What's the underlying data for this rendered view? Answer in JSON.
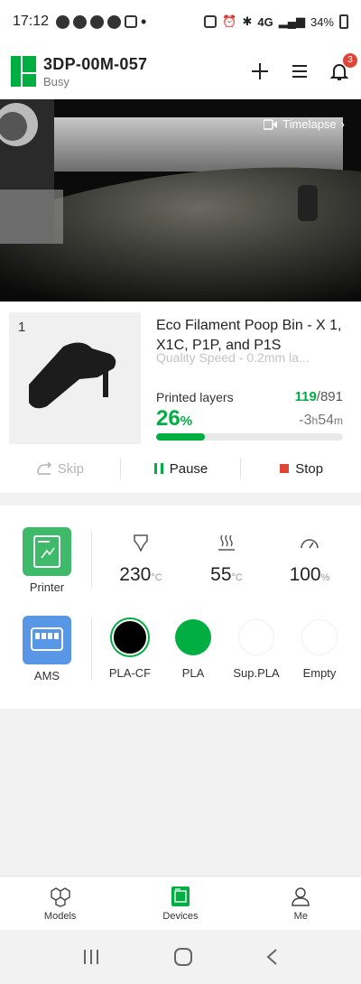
{
  "status_bar": {
    "time": "17:12",
    "network": "4G",
    "battery": "34%",
    "icons": [
      "chat-icon",
      "snapchat-icon",
      "at-icon",
      "clock-icon",
      "calendar-icon",
      "battery-saver-icon",
      "alarm-icon",
      "bluetooth-icon",
      "signal-icon"
    ]
  },
  "header": {
    "title": "3DP-00M-057",
    "status": "Busy",
    "notification_count": "3"
  },
  "camera": {
    "timelapse_label": "Timelapse"
  },
  "job": {
    "plate_number": "1",
    "name": "Eco Filament Poop Bin - X 1, X1C, P1P, and P1S",
    "subtitle": "Quality Speed - 0.2mm la...",
    "layers_label": "Printed layers",
    "layers_current": "119",
    "layers_total": "/891",
    "percent": "26",
    "percent_unit": "%",
    "progress": 0.26,
    "remaining_prefix": "-",
    "remaining_h": "3",
    "remaining_h_unit": "h",
    "remaining_m": "54",
    "remaining_m_unit": "m",
    "skip_label": "Skip",
    "pause_label": "Pause",
    "stop_label": "Stop"
  },
  "status": {
    "printer_label": "Printer",
    "nozzle_temp": "230",
    "bed_temp": "55",
    "temp_unit": "°C",
    "speed": "100",
    "speed_unit": "%",
    "ams_label": "AMS",
    "spools": [
      {
        "label": "PLA-CF",
        "color": "#000000"
      },
      {
        "label": "PLA",
        "color": "#00ae42"
      },
      {
        "label": "Sup.PLA",
        "color": "#ffffff"
      },
      {
        "label": "Empty",
        "color": "#ffffff"
      }
    ]
  },
  "nav": {
    "models": "Models",
    "devices": "Devices",
    "me": "Me"
  },
  "colors": {
    "accent": "#00ae42",
    "stop": "#e0453a"
  }
}
